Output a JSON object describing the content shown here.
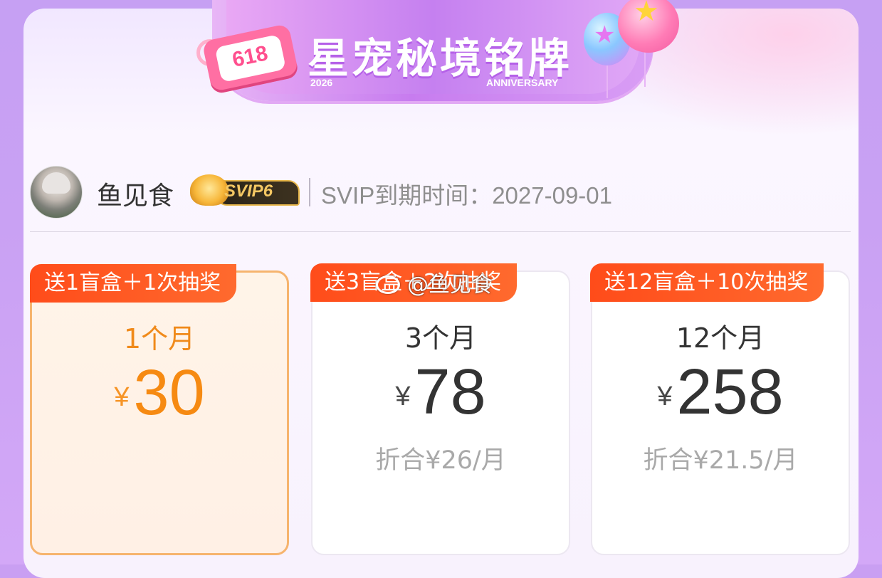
{
  "banner": {
    "tag": "618",
    "title": "星宠秘境铭牌",
    "year": "2026",
    "subtitle": "ANNIVERSARY"
  },
  "user": {
    "name": "鱼见食",
    "badge": "SVIP6",
    "expiry_label": "SVIP到期时间：",
    "expiry_date": "2027-09-01"
  },
  "plans": [
    {
      "promo": "送1盲盒＋1次抽奖",
      "period": "1个月",
      "currency": "¥",
      "price": "30",
      "monthly": "",
      "selected": true
    },
    {
      "promo": "送3盲盒＋2次抽奖",
      "period": "3个月",
      "currency": "¥",
      "price": "78",
      "monthly": "折合¥26/月",
      "selected": false
    },
    {
      "promo": "送12盲盒＋10次抽奖",
      "period": "12个月",
      "currency": "¥",
      "price": "258",
      "monthly": "折合¥21.5/月",
      "selected": false
    }
  ],
  "watermark": "@鱼见食",
  "colors": {
    "accent_orange": "#f68a12",
    "promo_tag": "#ff4c1a",
    "background_purple": "#c99ff2"
  }
}
